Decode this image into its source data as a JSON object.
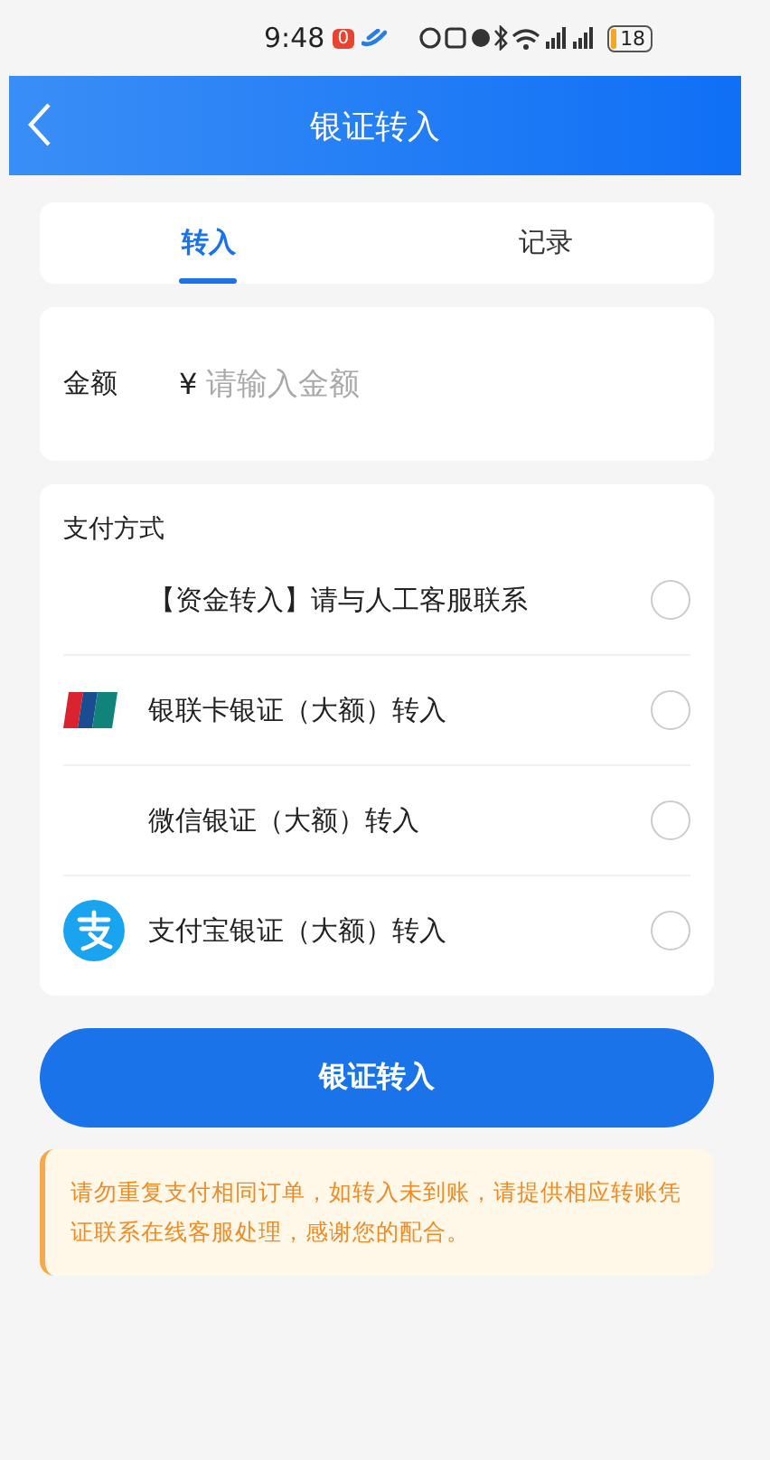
{
  "status_bar": {
    "time": "9:48",
    "notification_count": "0",
    "battery": "18"
  },
  "header": {
    "title": "银证转入"
  },
  "tabs": [
    {
      "label": "转入",
      "selected": true
    },
    {
      "label": "记录",
      "selected": false
    }
  ],
  "amount": {
    "label": "金额",
    "currency": "¥",
    "placeholder": "请输入金额"
  },
  "payment": {
    "title": "支付方式",
    "options": [
      {
        "label": "【资金转入】请与人工客服联系",
        "kind": "none",
        "selected": false
      },
      {
        "label": "银联卡银证（大额）转入",
        "kind": "unionpay",
        "selected": false
      },
      {
        "label": "微信银证（大额）转入",
        "kind": "none",
        "selected": false
      },
      {
        "label": "支付宝银证（大额）转入",
        "kind": "alipay",
        "selected": false
      }
    ]
  },
  "submit": {
    "label": "银证转入"
  },
  "notice": "请勿重复支付相同订单，如转入未到账，请提供相应转账凭证联系在线客服处理，感谢您的配合。"
}
